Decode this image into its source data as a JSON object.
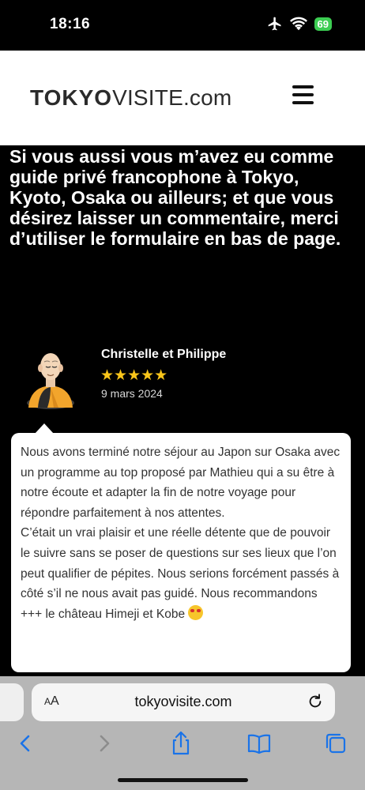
{
  "status_bar": {
    "time": "18:16",
    "battery": "69",
    "icons": [
      "airplane-icon",
      "wifi-icon",
      "battery-icon"
    ]
  },
  "header": {
    "logo_bold": "TOKYO",
    "logo_regular": "VISITE.com",
    "menu_icon": "hamburger-icon"
  },
  "intro": {
    "text": "Si vous aussi vous m’avez eu comme guide privé francophone à Tokyo, Kyoto, Osaka ou ailleurs; et que vous désirez laisser un commentaire, merci d’utiliser le formulaire en bas de page."
  },
  "review": {
    "name": "Christelle et Philippe",
    "stars": "★★★★★",
    "rating": 5,
    "date": "9 mars 2024",
    "paragraph1": "Nous avons terminé notre séjour au Japon sur Osaka avec un programme au top proposé par Mathieu qui a su être à notre écoute et adapter la fin de notre voyage pour répondre parfaitement à nos attentes.",
    "paragraph2": "C’était un vrai plaisir et une réelle détente que de pouvoir le suivre sans se poser de questions sur ses lieux que l’on peut qualifier de pépites. Nous serions forcément passés à côté s’il ne nous avait pas guidé. Nous recommandons +++ le château Himeji et Kobe"
  },
  "browser": {
    "aa_label_small": "A",
    "aa_label_large": "A",
    "url": "tokyovisite.com",
    "toolbar_icons": [
      "back-icon",
      "forward-icon",
      "share-icon",
      "bookmarks-icon",
      "tabs-icon"
    ],
    "accent_color": "#1a73e8"
  }
}
